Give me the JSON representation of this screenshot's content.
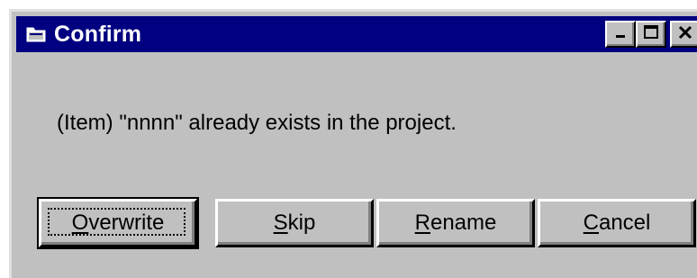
{
  "window": {
    "title": "Confirm",
    "icon": "folder-window-icon",
    "controls": [
      "minimize-icon",
      "maximize-icon",
      "close-icon"
    ]
  },
  "message": "(Item) \"nnnn\" already exists in the project.",
  "buttons": {
    "overwrite": {
      "accel": "O",
      "rest": "verwrite",
      "default": true
    },
    "skip": {
      "accel": "S",
      "rest": "kip"
    },
    "rename": {
      "accel": "R",
      "rest": "ename"
    },
    "cancel": {
      "accel": "C",
      "rest": "ancel"
    }
  },
  "colors": {
    "titlebar": "#000080",
    "face": "#c0c0c0"
  }
}
